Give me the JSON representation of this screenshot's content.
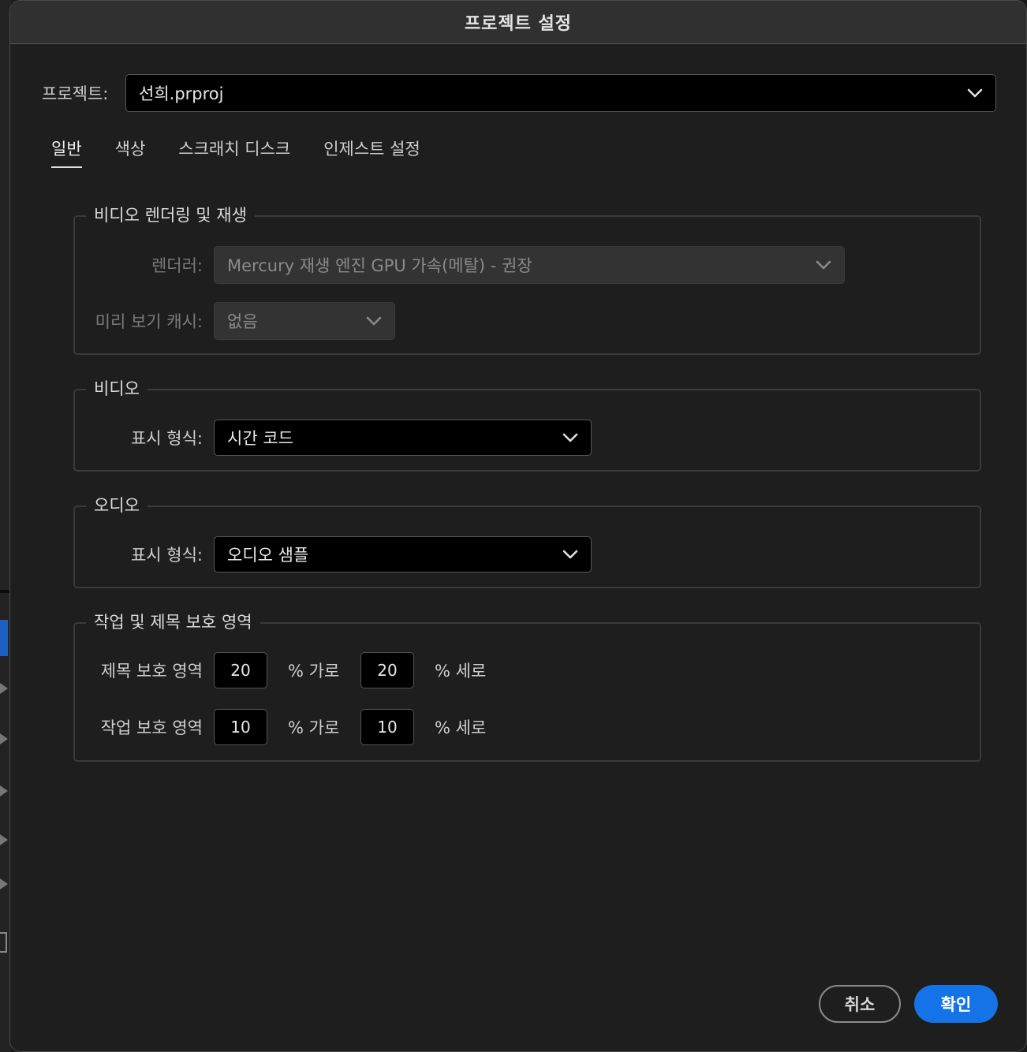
{
  "dialog": {
    "title": "프로젝트 설정"
  },
  "project": {
    "label": "프로젝트:",
    "value": "선희.prproj"
  },
  "tabs": [
    {
      "label": "일반"
    },
    {
      "label": "색상"
    },
    {
      "label": "스크래치 디스크"
    },
    {
      "label": "인제스트 설정"
    }
  ],
  "rendering": {
    "legend": "비디오 렌더링 및 재생",
    "renderer_label": "렌더러:",
    "renderer_value": "Mercury 재생 엔진 GPU 가속(메탈) - 권장",
    "cache_label": "미리 보기 캐시:",
    "cache_value": "없음"
  },
  "video": {
    "legend": "비디오",
    "format_label": "표시 형식:",
    "format_value": "시간 코드"
  },
  "audio": {
    "legend": "오디오",
    "format_label": "표시 형식:",
    "format_value": "오디오 샘플"
  },
  "safe_margins": {
    "legend": "작업 및 제목 보호 영역",
    "title_label": "제목 보호 영역",
    "title_h": "20",
    "title_h_unit": "% 가로",
    "title_v": "20",
    "title_v_unit": "% 세로",
    "action_label": "작업 보호 영역",
    "action_h": "10",
    "action_h_unit": "% 가로",
    "action_v": "10",
    "action_v_unit": "% 세로"
  },
  "buttons": {
    "cancel": "취소",
    "ok": "확인"
  },
  "colors": {
    "accent": "#1473e6",
    "background": "#1e1e1e",
    "titlebar": "#303030"
  }
}
